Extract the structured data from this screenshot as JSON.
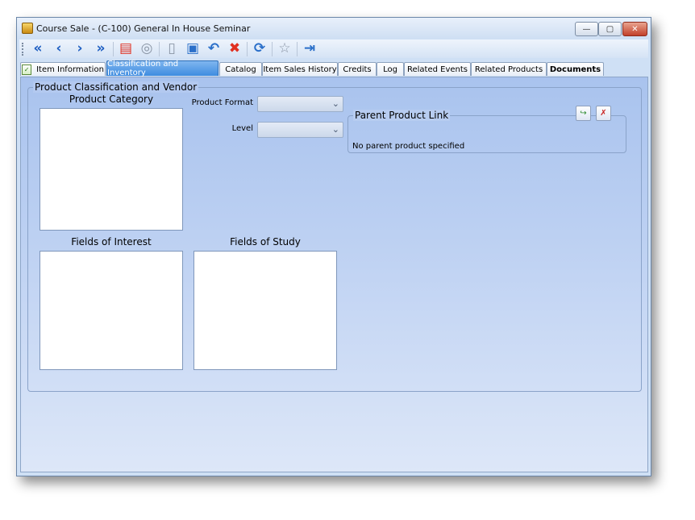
{
  "window": {
    "title": "Course Sale - (C-100) General In House Seminar",
    "controls": {
      "minimize": "—",
      "maximize": "▢",
      "close": "✕"
    }
  },
  "toolbar": {
    "buttons": [
      {
        "name": "first-record-icon",
        "glyph": "«"
      },
      {
        "name": "previous-record-icon",
        "glyph": "‹"
      },
      {
        "name": "next-record-icon",
        "glyph": "›"
      },
      {
        "name": "last-record-icon",
        "glyph": "»"
      },
      {
        "name": "report-icon",
        "glyph": "▤"
      },
      {
        "name": "find-icon",
        "glyph": "◎"
      },
      {
        "name": "new-record-icon",
        "glyph": "▯"
      },
      {
        "name": "save-icon",
        "glyph": "▣"
      },
      {
        "name": "undo-icon",
        "glyph": "↶"
      },
      {
        "name": "delete-icon",
        "glyph": "✖"
      },
      {
        "name": "refresh-icon",
        "glyph": "⟳"
      },
      {
        "name": "favorite-star-icon",
        "glyph": "☆"
      },
      {
        "name": "exit-icon",
        "glyph": "⇥"
      }
    ]
  },
  "tabs": [
    {
      "label": "Item Information",
      "active": false,
      "bold": false,
      "icon": "✓"
    },
    {
      "label": "Classification and Inventory",
      "active": true,
      "bold": false
    },
    {
      "label": "Catalog",
      "active": false,
      "bold": false
    },
    {
      "label": "Item Sales History",
      "active": false,
      "bold": false
    },
    {
      "label": "Credits",
      "active": false,
      "bold": false
    },
    {
      "label": "Log",
      "active": false,
      "bold": false
    },
    {
      "label": "Related Events",
      "active": false,
      "bold": false
    },
    {
      "label": "Related Products",
      "active": false,
      "bold": false
    },
    {
      "label": "Documents",
      "active": false,
      "bold": true
    }
  ],
  "group": {
    "title": "Product Classification and Vendor",
    "product_category_label": "Product Category",
    "fields_of_interest_label": "Fields of Interest",
    "fields_of_study_label": "Fields of Study",
    "product_format_label": "Product Format",
    "product_format_value": "",
    "level_label": "Level",
    "level_value": ""
  },
  "parent_link": {
    "title": "Parent Product Link",
    "status": "No parent product specified",
    "add_glyph": "↪",
    "remove_glyph": "✗"
  },
  "colors": {
    "active_tab": "#3f8ce0",
    "content_bg": "#bcd0f2"
  }
}
